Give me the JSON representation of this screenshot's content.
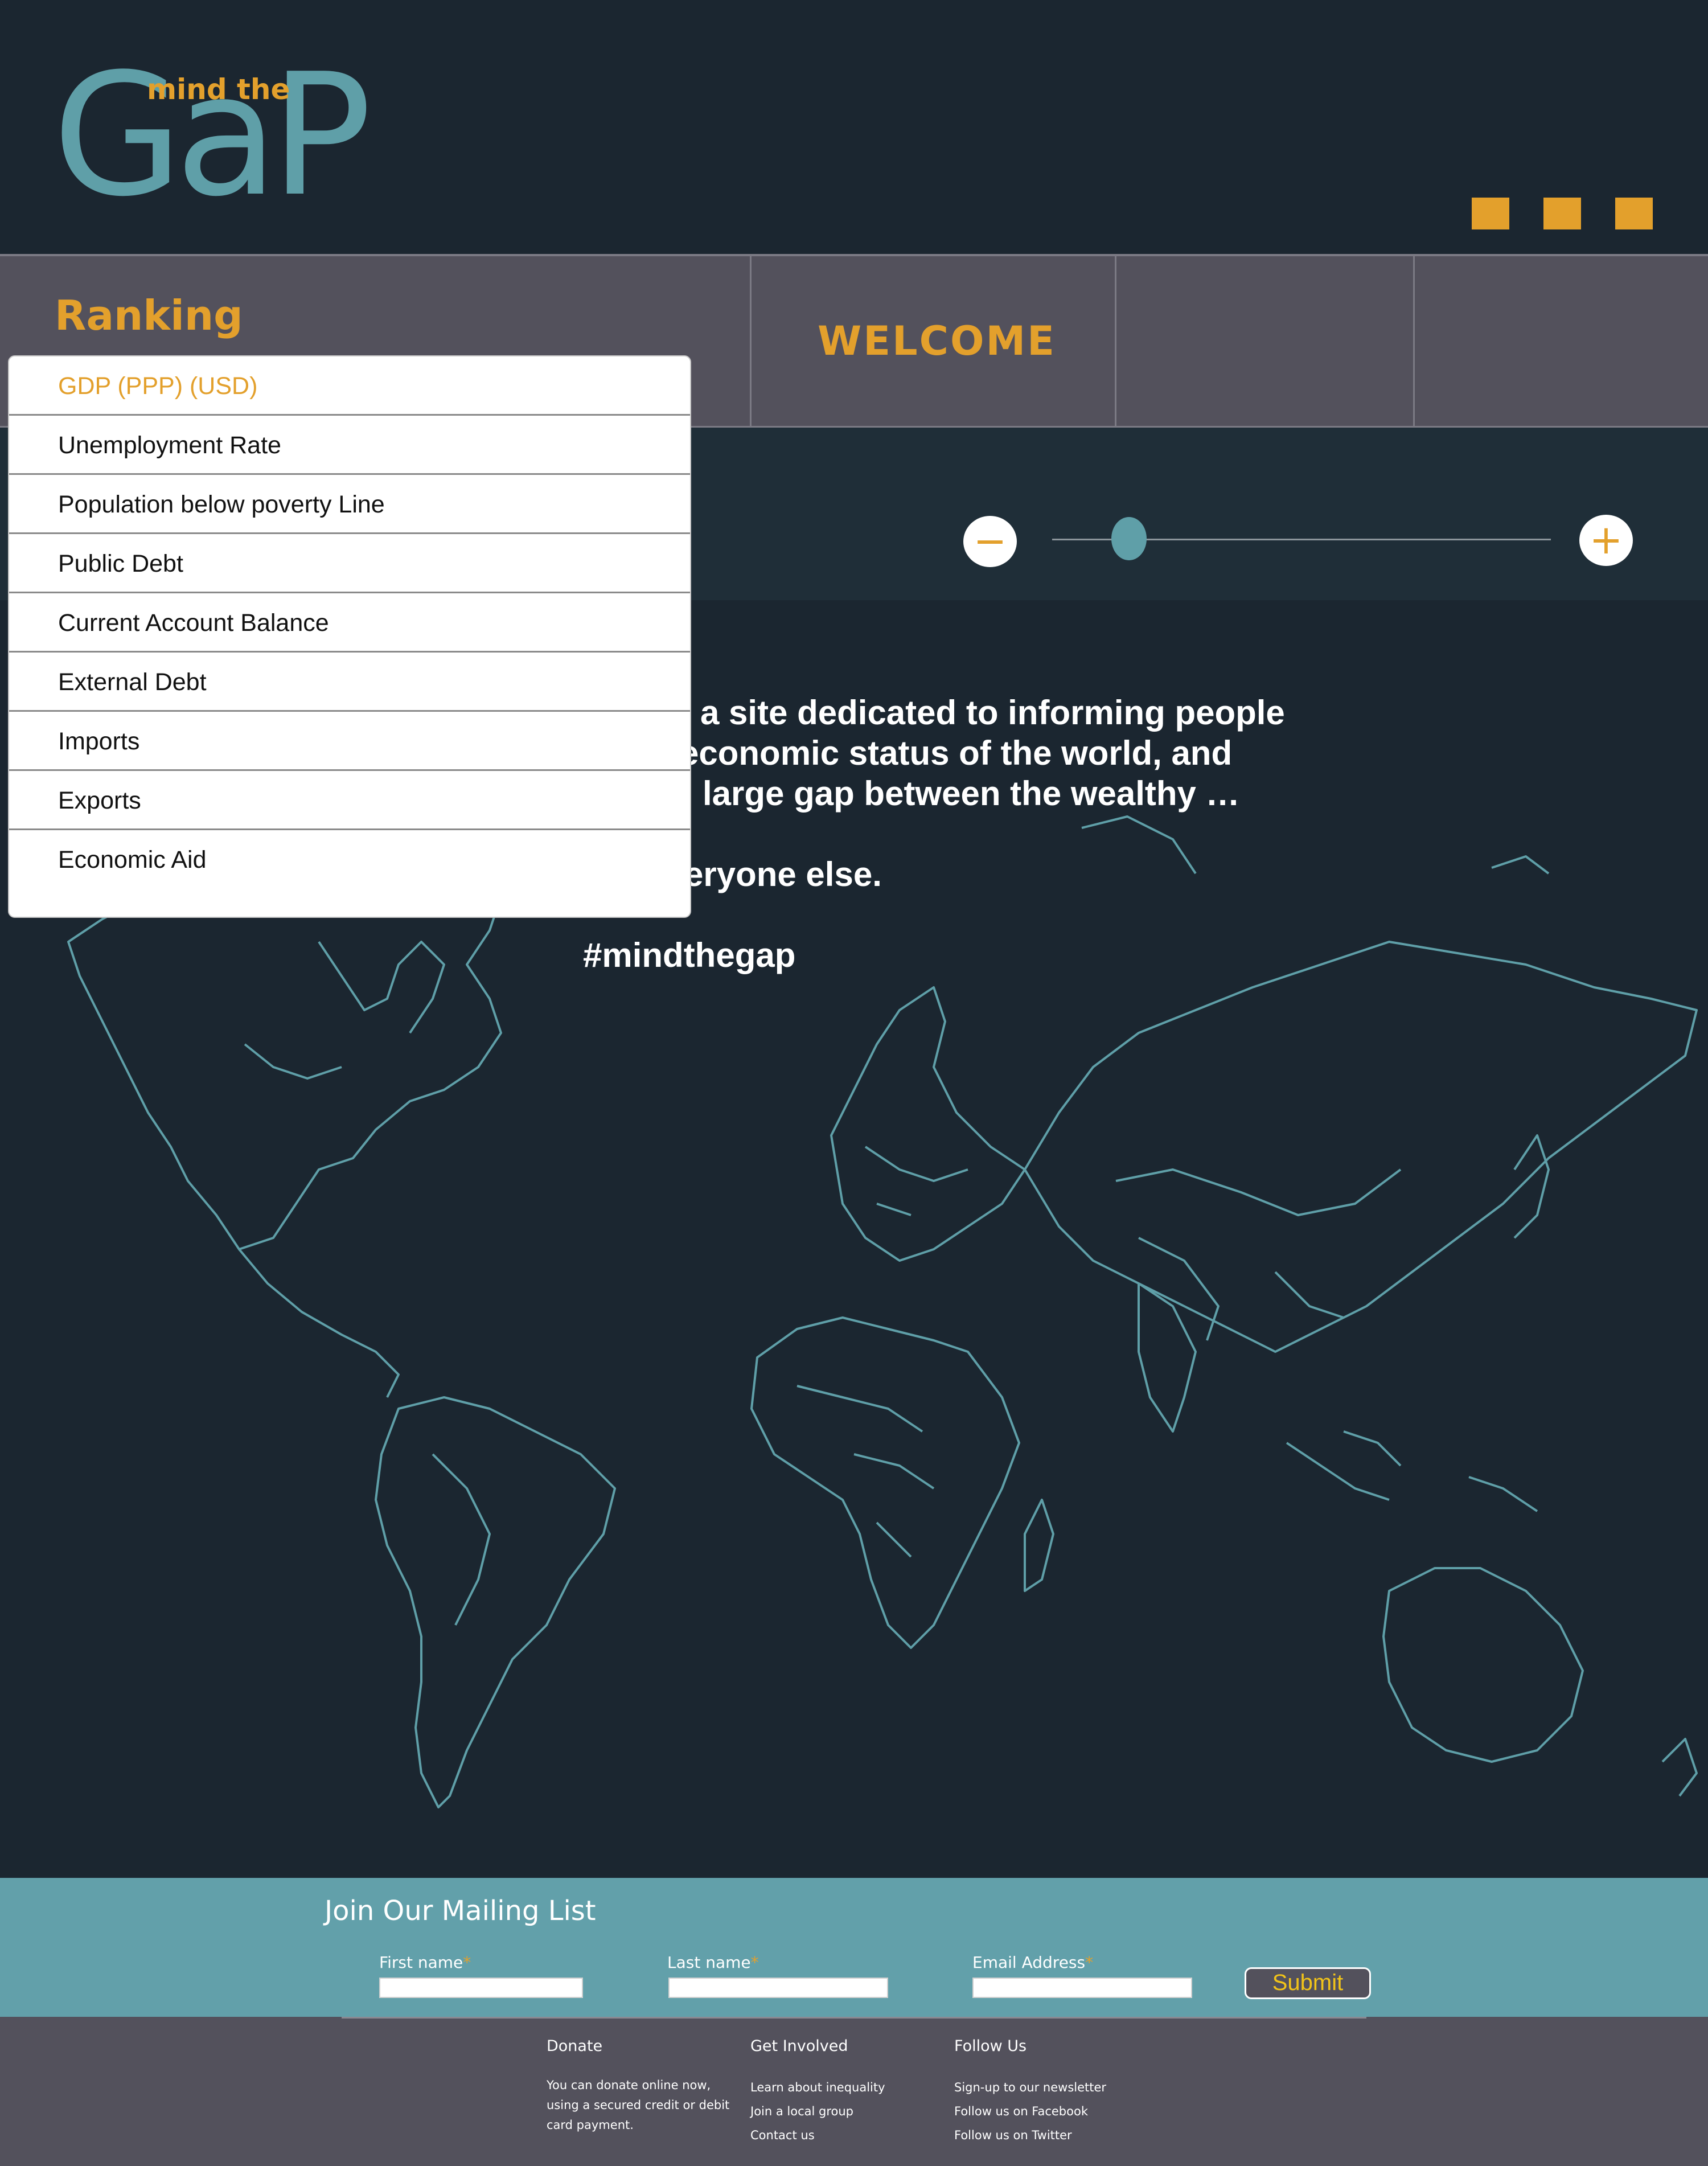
{
  "logo": {
    "word": "GaP",
    "tagline": "mind the"
  },
  "nav": {
    "ranking_label": "Ranking",
    "welcome_label": "WELCOME"
  },
  "ranking_dropdown": {
    "selected": "GDP (PPP) (USD)",
    "items": [
      "GDP (PPP) (USD)",
      "Unemployment Rate",
      "Population below poverty Line",
      "Public Debt",
      "Current Account Balance",
      "External Debt",
      "Imports",
      "Exports",
      "Economic Aid"
    ]
  },
  "zoom": {
    "minus_symbol": "−",
    "plus_symbol": "+",
    "level": 0.15
  },
  "intro": {
    "line1": "a site dedicated to informing people",
    "line2": "economic status of the world, and",
    "line3": "large gap between the wealthy …",
    "line4": "eryone else.",
    "hashtag": "#mindthegap"
  },
  "mailing": {
    "title": "Join Our Mailing List",
    "first_name_label": "First name",
    "last_name_label": "Last name",
    "email_label": "Email Address",
    "required_marker": "*",
    "submit_label": "Submit"
  },
  "footer": {
    "donate": {
      "title": "Donate",
      "text": "You can donate online now, using a secured credit or debit card payment."
    },
    "get_involved": {
      "title": "Get Involved",
      "links": [
        "Learn about inequality",
        "Join a local group",
        "Contact us"
      ]
    },
    "follow_us": {
      "title": "Follow Us",
      "links": [
        "Sign-up to our newsletter",
        "Follow us on Facebook",
        "Follow us on Twitter"
      ]
    }
  },
  "colors": {
    "background": "#1b2630",
    "accent": "#e3a02c",
    "teal": "#5f9fa8",
    "nav_gray": "#53515c",
    "mailing": "#62a0aa"
  },
  "icons": {
    "menu": "menu-squares-icon",
    "zoom_out": "minus-icon",
    "zoom_in": "plus-icon"
  }
}
